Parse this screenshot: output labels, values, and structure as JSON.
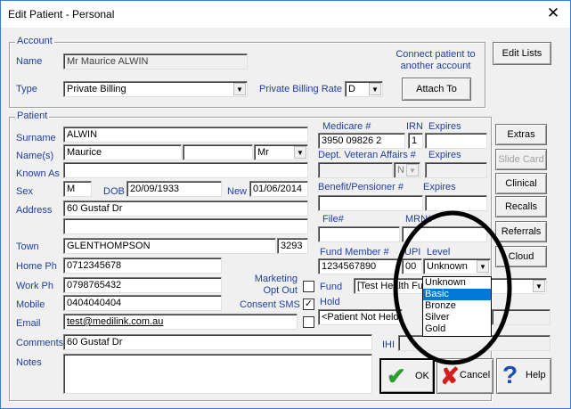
{
  "window": {
    "title": "Edit Patient - Personal",
    "close": "✕"
  },
  "account": {
    "group_title": "Account",
    "name_label": "Name",
    "name_value": "Mr Maurice ALWIN",
    "type_label": "Type",
    "type_value": "Private Billing",
    "rate_label": "Private Billing Rate",
    "rate_value": "D",
    "connect_text": "Connect patient to another account",
    "attach_label": "Attach To"
  },
  "edit_lists_label": "Edit Lists",
  "patient": {
    "group_title": "Patient",
    "surname_label": "Surname",
    "surname_value": "ALWIN",
    "names_label": "Name(s)",
    "given_name": "Maurice",
    "middle_name": "",
    "title_value": "Mr",
    "known_as_label": "Known As",
    "known_as_value": "",
    "sex_label": "Sex",
    "sex_value": "M",
    "dob_label": "DOB",
    "dob_value": "20/09/1933",
    "new_label": "New",
    "new_value": "01/06/2014",
    "address_label": "Address",
    "address_line1": "60 Gustaf Dr",
    "address_line2": "",
    "town_label": "Town",
    "town_value": "GLENTHOMPSON",
    "postcode_value": "3293",
    "home_ph_label": "Home Ph",
    "home_ph_value": "0712345678",
    "work_ph_label": "Work Ph",
    "work_ph_value": "0798765432",
    "mobile_label": "Mobile",
    "mobile_value": "0404040404",
    "email_label": "Email",
    "email_value": "test@medilink.com.au",
    "marketing_label": "Marketing Opt Out",
    "consent_sms_label": "Consent SMS",
    "consent_sms_check": "✓",
    "comments_label": "Comments",
    "comments_value": "60 Gustaf Dr",
    "notes_label": "Notes"
  },
  "cards": {
    "medicare_label": "Medicare #",
    "medicare_value": "3950 09826 2",
    "irn_label": "IRN",
    "irn_value": "1",
    "expires_label": "Expires",
    "dva_label": "Dept. Veteran Affairs #",
    "dva_type": "N",
    "benefit_label": "Benefit/Pensioner #",
    "file_label": "File#",
    "mrn_label": "MRN#",
    "fund_member_label": "Fund Member #",
    "fund_member_value": "1234567890",
    "upi_label": "UPI",
    "upi_value": "00",
    "level_label": "Level",
    "level_value": "Unknown",
    "fund_label": "Fund",
    "fund_value": "[Test Health Fund]",
    "hold_label": "Hold",
    "hold_value": "<Patient Not Held>",
    "ihi_label": "IHI"
  },
  "level_options": [
    "Unknown",
    "Basic",
    "Bronze",
    "Silver",
    "Gold"
  ],
  "level_selected": "Basic",
  "side_buttons": {
    "extras": "Extras",
    "slide_card": "Slide Card",
    "clinical": "Clinical",
    "recalls": "Recalls",
    "referrals": "Referrals",
    "cloud": "Cloud"
  },
  "bottom_buttons": {
    "ok": "OK",
    "cancel": "Cancel",
    "help": "Help"
  },
  "colors": {
    "label_blue": "#1f3f9c",
    "selection": "#0078d7",
    "ok_green": "#2e9e2e",
    "cancel_red": "#d11f1f",
    "help_blue": "#1e4fb0"
  }
}
